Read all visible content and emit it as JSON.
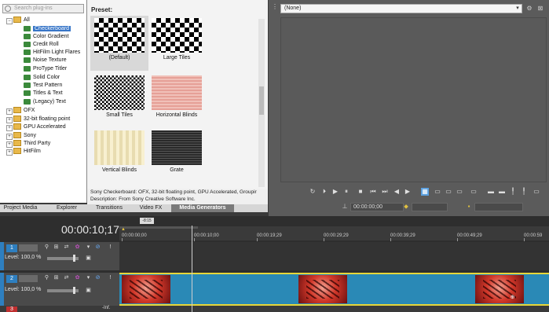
{
  "search": {
    "placeholder": "Search plug-ins"
  },
  "tree": {
    "root": "All",
    "generators": [
      "Checkerboard",
      "Color Gradient",
      "Credit Roll",
      "HitFilm Light Flares",
      "Noise Texture",
      "ProType Titler",
      "Solid Color",
      "Test Pattern",
      "Titles & Text",
      "(Legacy) Text"
    ],
    "selected": "Checkerboard",
    "folders": [
      "OFX",
      "32-bit floating point",
      "GPU Accelerated",
      "Sony",
      "Third Party",
      "HitFilm"
    ]
  },
  "preset": {
    "title": "Preset:",
    "items": [
      "(Default)",
      "Large Tiles",
      "Small Tiles",
      "Horizontal Blinds",
      "Vertical Blinds",
      "Grate"
    ],
    "description_line1": "Sony Checkerboard: OFX, 32-bit floating point, GPU Accelerated, Groupir",
    "description_line2": "Description: From Sony Creative Software Inc."
  },
  "tabs": {
    "items": [
      "Project Media",
      "Explorer",
      "Transitions",
      "Video FX",
      "Media Generators"
    ],
    "active": "Media Generators"
  },
  "preview": {
    "select_value": "(None)",
    "timecode": "00:00:00;00"
  },
  "timeline": {
    "timecode": "00:00:10;17",
    "marker": "-8:15",
    "ruler_labels": [
      "00:00:00;00",
      "00:00:10;00",
      "00:00:19;29",
      "00:00:29;29",
      "00:00:39;29",
      "00:00:49;29",
      "00:00:59"
    ],
    "tracks": [
      {
        "number": "1",
        "level": "Level: 100,0 %",
        "color": "#2e7fc0"
      },
      {
        "number": "2",
        "level": "Level: 100,0 %",
        "color": "#2e7fc0"
      },
      {
        "number": "3",
        "level": "",
        "color": "#c03030"
      }
    ],
    "track3_label": "-Inf."
  },
  "colors": {
    "accent": "#3876c8",
    "track_blue": "#2a89b6",
    "selection_border": "#e6d63a",
    "clip_red": "#d2382a"
  }
}
